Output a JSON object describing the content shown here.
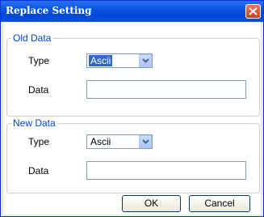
{
  "window": {
    "title": "Replace Setting"
  },
  "old_data": {
    "legend": "Old Data",
    "type_label": "Type",
    "type_value": "Ascii",
    "data_label": "Data",
    "data_value": ""
  },
  "new_data": {
    "legend": "New Data",
    "type_label": "Type",
    "type_value": "Ascii",
    "data_label": "Data",
    "data_value": ""
  },
  "buttons": {
    "ok": "OK",
    "cancel": "Cancel"
  },
  "colors": {
    "titlebar": "#0a55e0",
    "legend": "#0046d5",
    "selection": "#316ac5"
  },
  "icons": {
    "close": "close-icon",
    "dropdown": "chevron-down-icon"
  }
}
